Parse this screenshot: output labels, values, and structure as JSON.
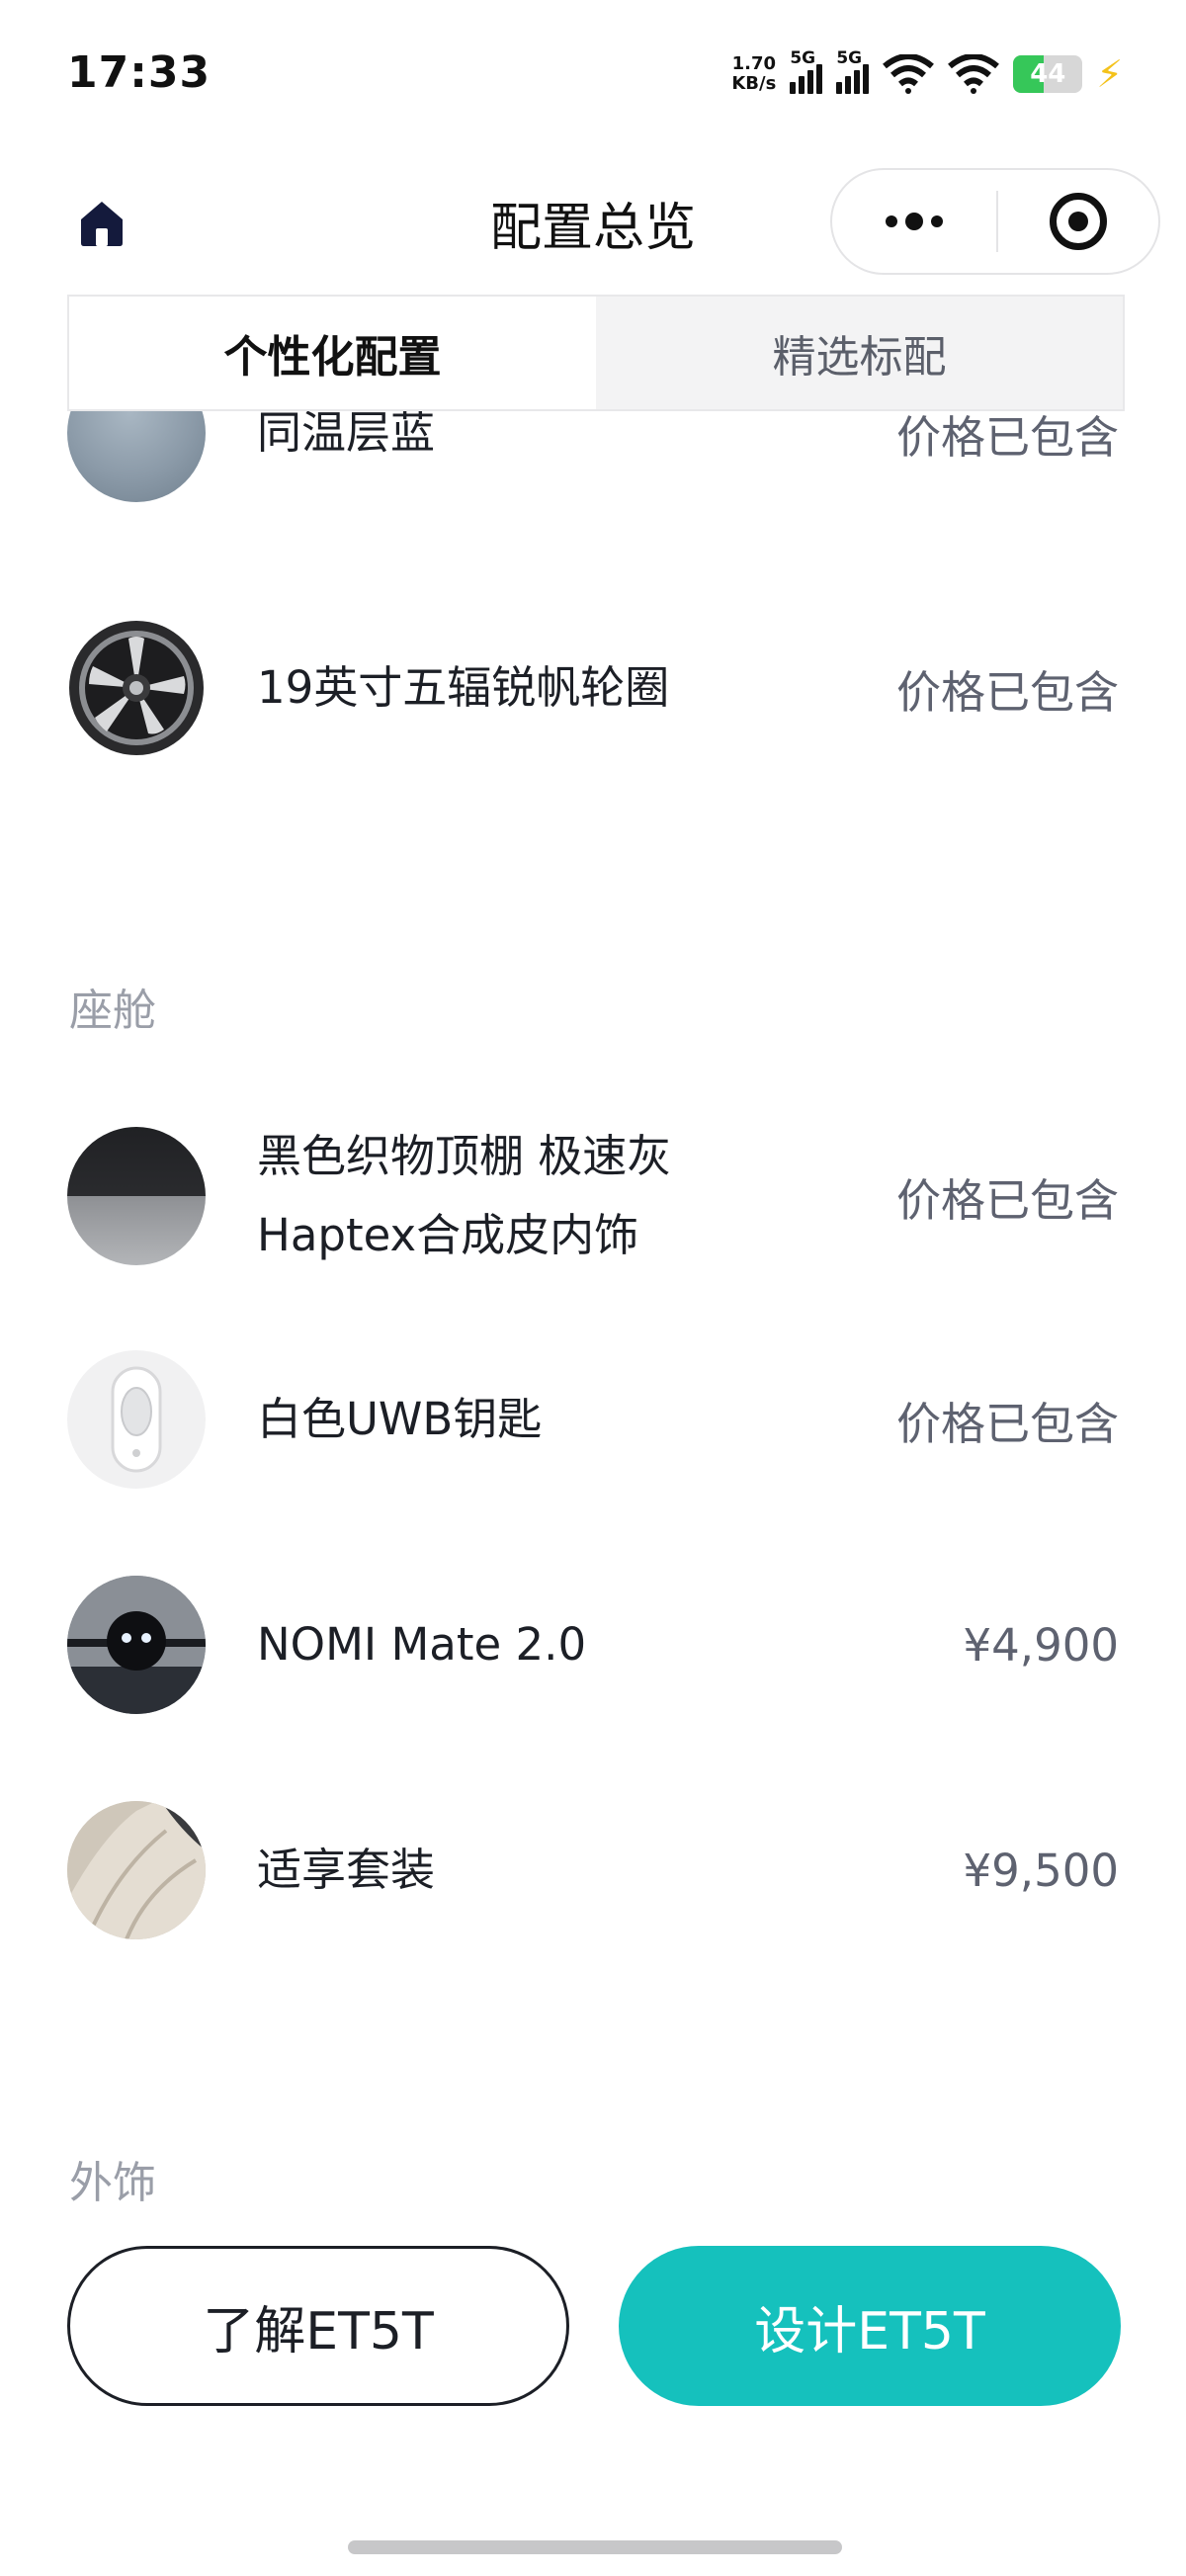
{
  "status_bar": {
    "time": "17:33",
    "net_speed_value": "1.70",
    "net_speed_unit": "KB/s",
    "sim1_label": "5G",
    "sim2_label": "5G",
    "battery_level": "44",
    "battery_percent": 44,
    "battery_color": "#36c759"
  },
  "header": {
    "title": "配置总览",
    "home_icon": "home-icon",
    "more_icon": "more-dots-icon",
    "close_icon": "target-circle-icon"
  },
  "tabs": [
    {
      "label": "个性化配置",
      "active": true
    },
    {
      "label": "精选标配",
      "active": false
    }
  ],
  "items_top": [
    {
      "name": "同温层蓝",
      "price": "价格已包含",
      "thumb": "color-swatch-stratosphere-blue"
    },
    {
      "name": "19英寸五辐锐帆轮圈",
      "price": "价格已包含",
      "thumb": "wheel-rim"
    }
  ],
  "sections": [
    {
      "title": "座舱",
      "items": [
        {
          "name_line1": "黑色织物顶棚 极速灰",
          "name_line2": "Haptex合成皮内饰",
          "price": "价格已包含",
          "thumb": "interior-swatch"
        },
        {
          "name": "白色UWB钥匙",
          "price": "价格已包含",
          "thumb": "uwb-key"
        },
        {
          "name": "NOMI Mate 2.0",
          "price": "¥4,900",
          "thumb": "nomi-robot"
        },
        {
          "name": "适享套装",
          "price": "¥9,500",
          "thumb": "comfort-seat"
        }
      ]
    },
    {
      "title": "外饰",
      "items": []
    }
  ],
  "buttons": {
    "learn": "了解ET5T",
    "design": "设计ET5T"
  },
  "colors": {
    "accent": "#15c1bd",
    "text_primary": "#1c1f26",
    "text_secondary": "#5e6270",
    "section_title": "#9a9ea8"
  }
}
